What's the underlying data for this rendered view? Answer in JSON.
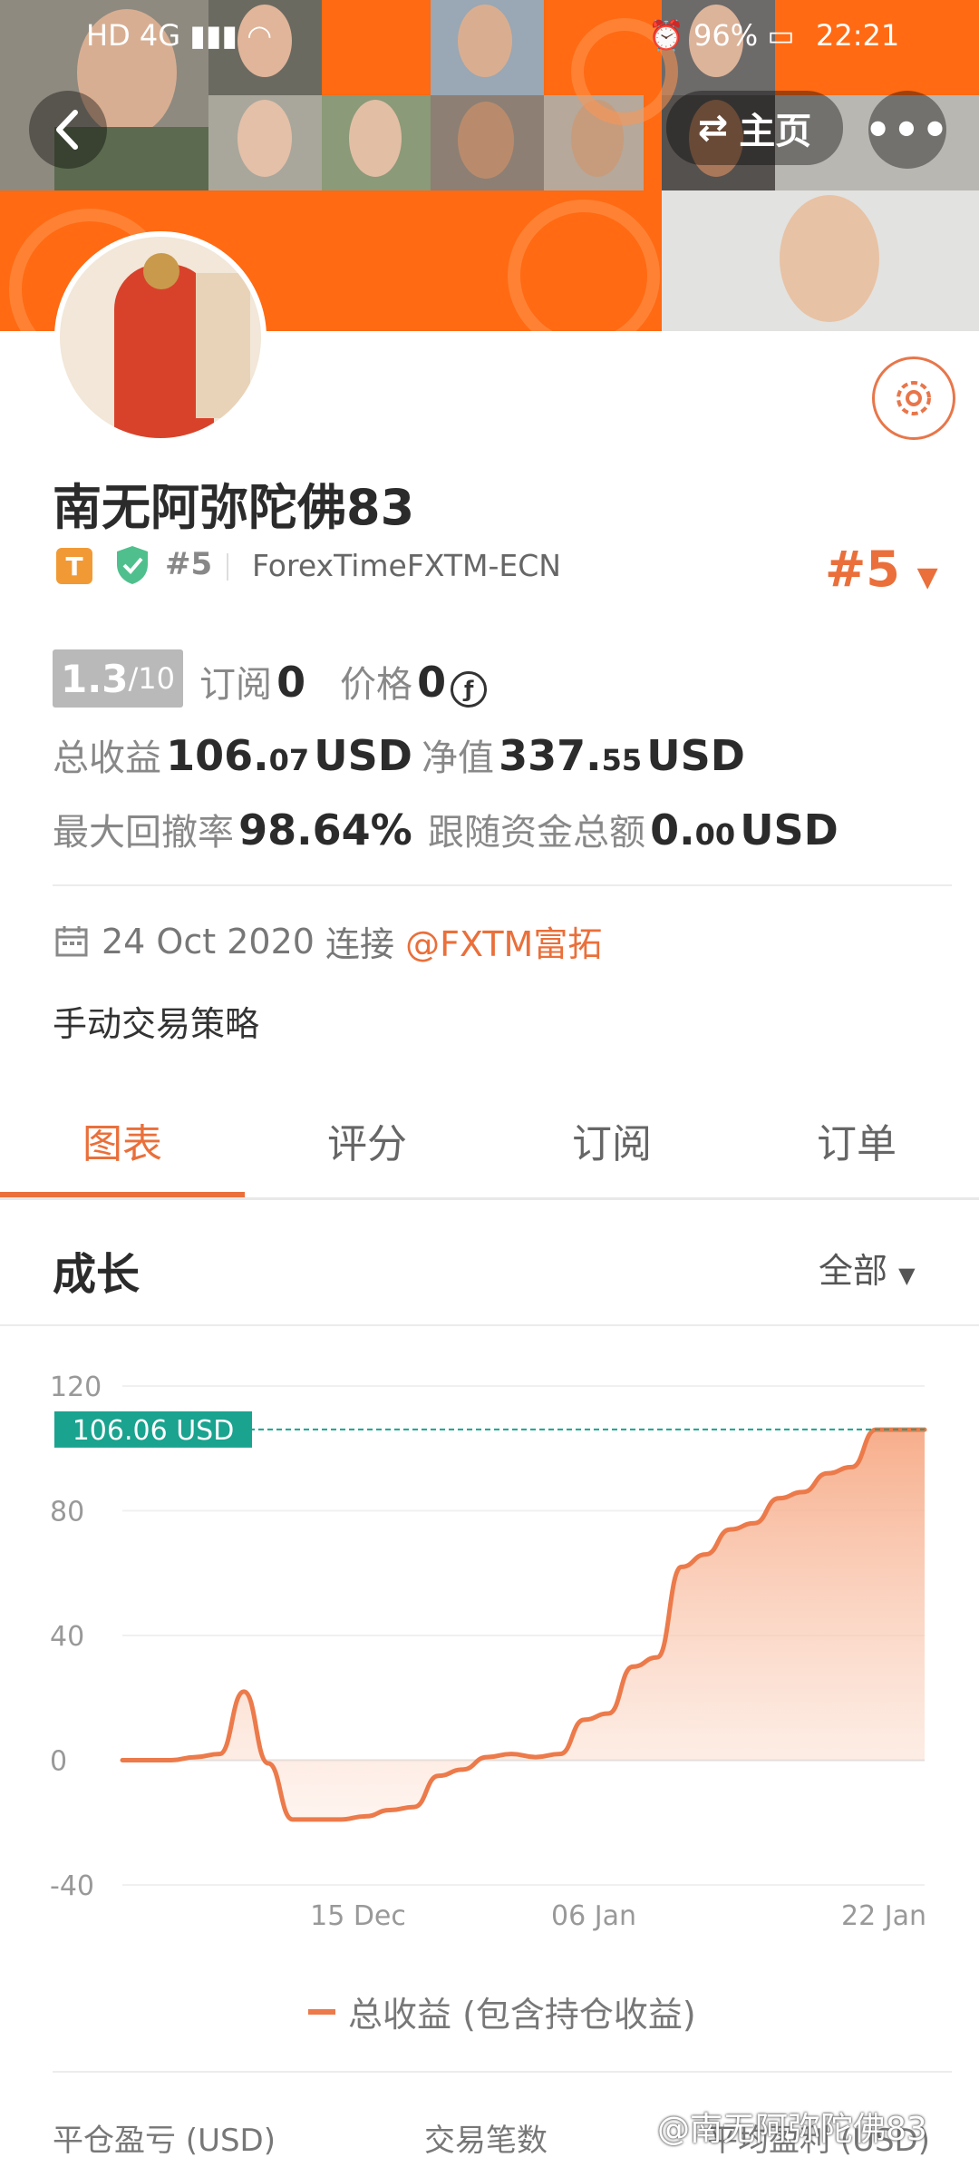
{
  "status_bar": {
    "network": "HD 4G",
    "battery": "96%",
    "time": "22:21"
  },
  "header": {
    "back_icon": "back-icon",
    "home_label": "主页",
    "more_icon": "more-icon"
  },
  "profile": {
    "name": "南无阿弥陀佛83",
    "tier_badge": "T",
    "rank": "#5",
    "broker": "ForexTimeFXTM-ECN",
    "rank_big": "#5",
    "score": "1.3",
    "score_max": "/10"
  },
  "stats": {
    "subscriptions_label": "订阅",
    "subscriptions_value": "0",
    "price_label": "价格",
    "price_value": "0",
    "total_profit_label": "总收益",
    "total_profit_int": "106.",
    "total_profit_dec": "07",
    "total_profit_unit": "USD",
    "equity_label": "净值",
    "equity_int": "337.",
    "equity_dec": "55",
    "equity_unit": "USD",
    "max_drawdown_label": "最大回撤率",
    "max_drawdown_value": "98.64%",
    "follow_funds_label": "跟随资金总额",
    "follow_funds_int": "0.",
    "follow_funds_dec": "00",
    "follow_funds_unit": "USD"
  },
  "connection": {
    "date": "24 Oct 2020",
    "connect_label": "连接",
    "broker_link": "@FXTM富拓"
  },
  "strategy": "手动交易策略",
  "tabs": [
    "图表",
    "评分",
    "订阅",
    "订单"
  ],
  "active_tab": 0,
  "section": {
    "title": "成长",
    "filter": "全部"
  },
  "chart_data": {
    "type": "area",
    "series": [
      {
        "name": "总收益 (包含持仓收益)",
        "color": "#ec7a4a",
        "values": [
          0,
          0,
          0,
          1,
          2,
          22,
          -1,
          -19,
          -19,
          -19,
          -18,
          -16,
          -15,
          -5,
          -3,
          1,
          2,
          1,
          2,
          13,
          15,
          30,
          33,
          62,
          66,
          74,
          76,
          84,
          86,
          92,
          94,
          106,
          106,
          106
        ]
      }
    ],
    "x_ticks": [
      "15 Dec",
      "06 Jan",
      "22 Jan"
    ],
    "y_ticks": [
      120,
      80,
      40,
      0,
      -40
    ],
    "ylim": [
      -40,
      120
    ],
    "current_label": "106.06 USD",
    "current_value": 106.06,
    "accent": "#1aa38f"
  },
  "legend_label": "总收益 (包含持仓收益)",
  "footer": {
    "col1": "平仓盈亏 (USD)",
    "col2": "交易笔数",
    "col3": "平均盈利 (USD)",
    "watermark": "@南无阿弥陀佛83"
  }
}
